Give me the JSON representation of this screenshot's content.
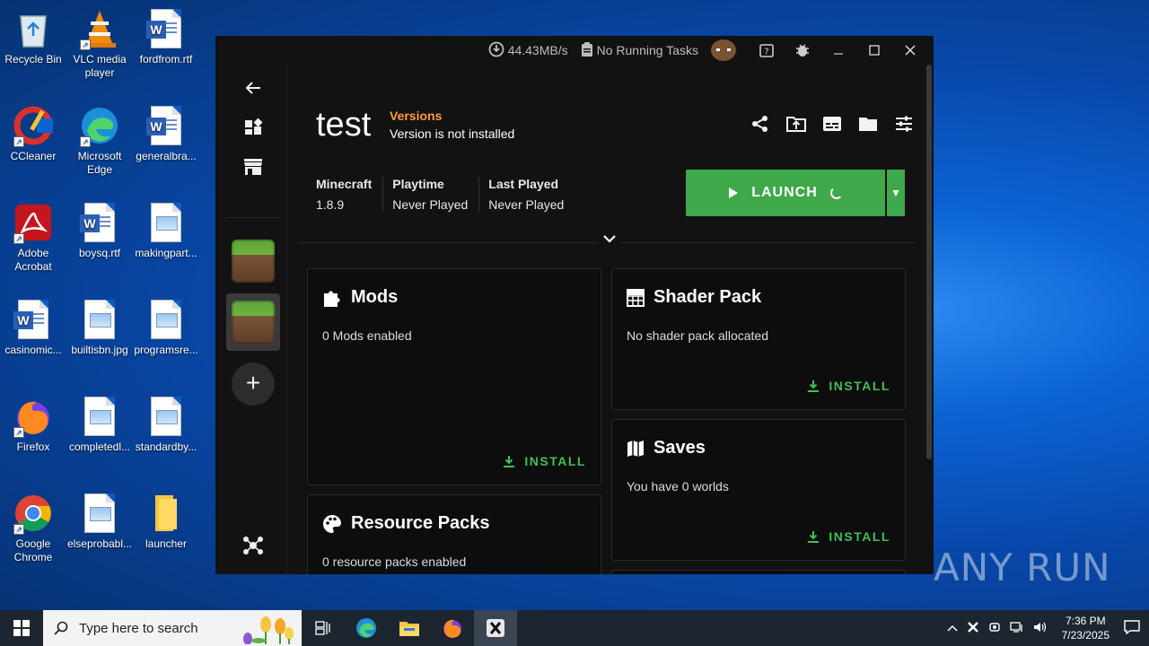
{
  "desktop": {
    "icons": [
      {
        "label": "Recycle Bin",
        "icon": "recycle-bin-icon"
      },
      {
        "label": "VLC media player",
        "icon": "vlc-icon"
      },
      {
        "label": "fordfrom.rtf",
        "icon": "word-doc-icon"
      },
      {
        "label": "CCleaner",
        "icon": "ccleaner-icon"
      },
      {
        "label": "Microsoft Edge",
        "icon": "edge-icon"
      },
      {
        "label": "generalbra...",
        "icon": "word-doc-icon"
      },
      {
        "label": "Adobe Acrobat",
        "icon": "acrobat-icon"
      },
      {
        "label": "boysq.rtf",
        "icon": "word-doc-icon"
      },
      {
        "label": "makingpart...",
        "icon": "image-file-icon"
      },
      {
        "label": "casinomic...",
        "icon": "word-doc-icon"
      },
      {
        "label": "builtisbn.jpg",
        "icon": "image-file-icon"
      },
      {
        "label": "programsre...",
        "icon": "image-file-icon"
      },
      {
        "label": "Firefox",
        "icon": "firefox-icon"
      },
      {
        "label": "completedl...",
        "icon": "image-file-icon"
      },
      {
        "label": "standardby...",
        "icon": "image-file-icon"
      },
      {
        "label": "Google Chrome",
        "icon": "chrome-icon"
      },
      {
        "label": "elseprobabl...",
        "icon": "image-file-icon"
      },
      {
        "label": "launcher",
        "icon": "folder-icon"
      }
    ]
  },
  "titlebar": {
    "speed": "44.43MB/s",
    "tasks": "No Running Tasks"
  },
  "instance": {
    "name": "test",
    "versions_label": "Versions",
    "versions_status": "Version is not installed"
  },
  "stats": [
    {
      "key": "Minecraft",
      "value": "1.8.9"
    },
    {
      "key": "Playtime",
      "value": "Never Played"
    },
    {
      "key": "Last Played",
      "value": "Never Played"
    }
  ],
  "launch_label": "LAUNCH",
  "cards": {
    "mods": {
      "title": "Mods",
      "desc": "0 Mods enabled",
      "action": "INSTALL"
    },
    "shader": {
      "title": "Shader Pack",
      "desc": "No shader pack allocated",
      "action": "INSTALL"
    },
    "saves": {
      "title": "Saves",
      "desc": "You have 0 worlds",
      "action": "INSTALL"
    },
    "resource": {
      "title": "Resource Packs",
      "desc": "0 resource packs enabled"
    }
  },
  "taskbar": {
    "search_placeholder": "Type here to search",
    "time": "7:36 PM",
    "date": "7/23/2025"
  },
  "watermark": "ANY RUN",
  "colors": {
    "accent_green": "#3fa84a",
    "versions_orange": "#ff9a3c",
    "install_green": "#3fbf55"
  }
}
